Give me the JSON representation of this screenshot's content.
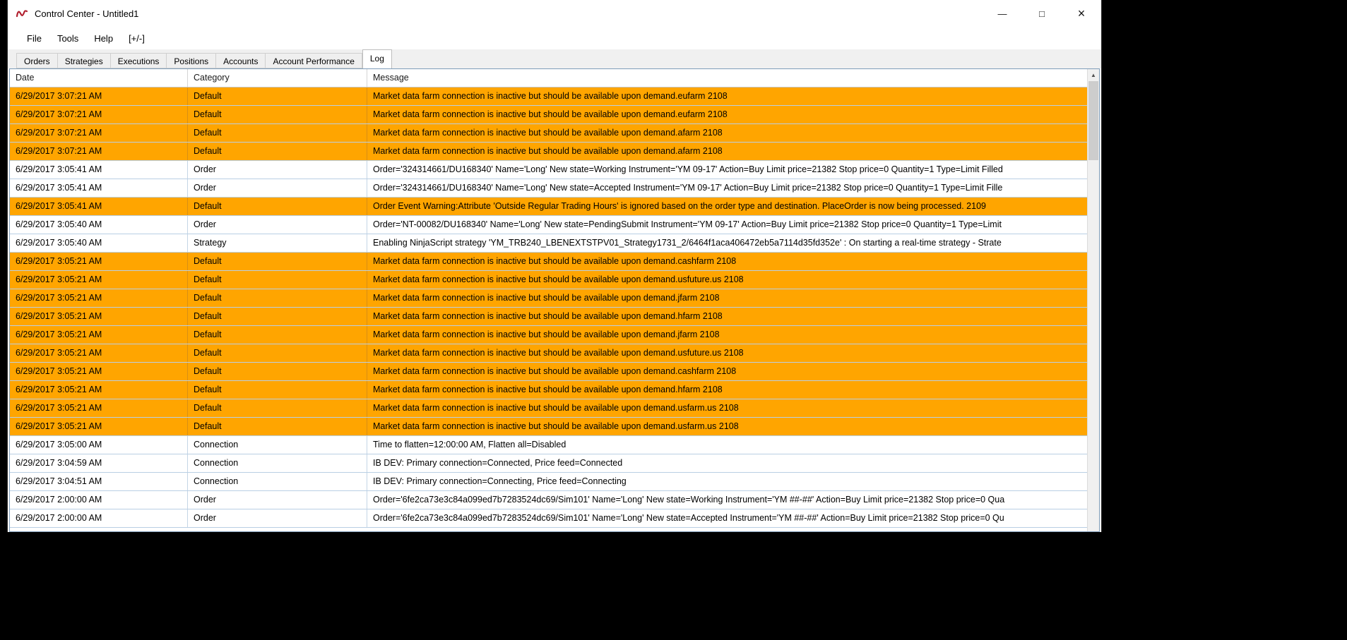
{
  "window": {
    "title": "Control Center - Untitled1",
    "controls": {
      "minimize": "—",
      "maximize": "□",
      "close": "×"
    }
  },
  "menu": {
    "items": [
      "File",
      "Tools",
      "Help",
      "[+/-]"
    ]
  },
  "tabs": [
    {
      "label": "Orders",
      "active": false
    },
    {
      "label": "Strategies",
      "active": false
    },
    {
      "label": "Executions",
      "active": false
    },
    {
      "label": "Positions",
      "active": false
    },
    {
      "label": "Accounts",
      "active": false
    },
    {
      "label": "Account Performance",
      "active": false
    },
    {
      "label": "Log",
      "active": true
    }
  ],
  "table": {
    "columns": [
      "Date",
      "Category",
      "Message"
    ],
    "rows": [
      {
        "date": "6/29/2017 3:07:21 AM",
        "category": "Default",
        "message": "Market data farm connection is inactive but should be available upon demand.eufarm 2108",
        "highlight": true
      },
      {
        "date": "6/29/2017 3:07:21 AM",
        "category": "Default",
        "message": "Market data farm connection is inactive but should be available upon demand.eufarm 2108",
        "highlight": true
      },
      {
        "date": "6/29/2017 3:07:21 AM",
        "category": "Default",
        "message": "Market data farm connection is inactive but should be available upon demand.afarm 2108",
        "highlight": true
      },
      {
        "date": "6/29/2017 3:07:21 AM",
        "category": "Default",
        "message": "Market data farm connection is inactive but should be available upon demand.afarm 2108",
        "highlight": true
      },
      {
        "date": "6/29/2017 3:05:41 AM",
        "category": "Order",
        "message": "Order='324314661/DU168340' Name='Long' New state=Working Instrument='YM 09-17' Action=Buy Limit price=21382 Stop price=0 Quantity=1 Type=Limit Filled",
        "highlight": false
      },
      {
        "date": "6/29/2017 3:05:41 AM",
        "category": "Order",
        "message": "Order='324314661/DU168340' Name='Long' New state=Accepted Instrument='YM 09-17' Action=Buy Limit price=21382 Stop price=0 Quantity=1 Type=Limit Fille",
        "highlight": false
      },
      {
        "date": "6/29/2017 3:05:41 AM",
        "category": "Default",
        "message": "Order Event Warning:Attribute 'Outside Regular Trading Hours' is ignored based on the order type and destination. PlaceOrder is now being processed. 2109",
        "highlight": true
      },
      {
        "date": "6/29/2017 3:05:40 AM",
        "category": "Order",
        "message": "Order='NT-00082/DU168340' Name='Long' New state=PendingSubmit Instrument='YM 09-17' Action=Buy Limit price=21382 Stop price=0 Quantity=1 Type=Limit",
        "highlight": false
      },
      {
        "date": "6/29/2017 3:05:40 AM",
        "category": "Strategy",
        "message": "Enabling NinjaScript strategy 'YM_TRB240_LBENEXTSTPV01_Strategy1731_2/6464f1aca406472eb5a7114d35fd352e' : On starting a real-time strategy - Strate",
        "highlight": false
      },
      {
        "date": "6/29/2017 3:05:21 AM",
        "category": "Default",
        "message": "Market data farm connection is inactive but should be available upon demand.cashfarm 2108",
        "highlight": true
      },
      {
        "date": "6/29/2017 3:05:21 AM",
        "category": "Default",
        "message": "Market data farm connection is inactive but should be available upon demand.usfuture.us 2108",
        "highlight": true
      },
      {
        "date": "6/29/2017 3:05:21 AM",
        "category": "Default",
        "message": "Market data farm connection is inactive but should be available upon demand.jfarm 2108",
        "highlight": true
      },
      {
        "date": "6/29/2017 3:05:21 AM",
        "category": "Default",
        "message": "Market data farm connection is inactive but should be available upon demand.hfarm 2108",
        "highlight": true
      },
      {
        "date": "6/29/2017 3:05:21 AM",
        "category": "Default",
        "message": "Market data farm connection is inactive but should be available upon demand.jfarm 2108",
        "highlight": true
      },
      {
        "date": "6/29/2017 3:05:21 AM",
        "category": "Default",
        "message": "Market data farm connection is inactive but should be available upon demand.usfuture.us 2108",
        "highlight": true
      },
      {
        "date": "6/29/2017 3:05:21 AM",
        "category": "Default",
        "message": "Market data farm connection is inactive but should be available upon demand.cashfarm 2108",
        "highlight": true
      },
      {
        "date": "6/29/2017 3:05:21 AM",
        "category": "Default",
        "message": "Market data farm connection is inactive but should be available upon demand.hfarm 2108",
        "highlight": true
      },
      {
        "date": "6/29/2017 3:05:21 AM",
        "category": "Default",
        "message": "Market data farm connection is inactive but should be available upon demand.usfarm.us 2108",
        "highlight": true
      },
      {
        "date": "6/29/2017 3:05:21 AM",
        "category": "Default",
        "message": "Market data farm connection is inactive but should be available upon demand.usfarm.us 2108",
        "highlight": true
      },
      {
        "date": "6/29/2017 3:05:00 AM",
        "category": "Connection",
        "message": "Time to flatten=12:00:00 AM, Flatten all=Disabled",
        "highlight": false
      },
      {
        "date": "6/29/2017 3:04:59 AM",
        "category": "Connection",
        "message": "IB DEV: Primary connection=Connected, Price feed=Connected",
        "highlight": false
      },
      {
        "date": "6/29/2017 3:04:51 AM",
        "category": "Connection",
        "message": "IB DEV: Primary connection=Connecting, Price feed=Connecting",
        "highlight": false
      },
      {
        "date": "6/29/2017 2:00:00 AM",
        "category": "Order",
        "message": "Order='6fe2ca73e3c84a099ed7b7283524dc69/Sim101' Name='Long' New state=Working Instrument='YM ##-##' Action=Buy Limit price=21382 Stop price=0 Qua",
        "highlight": false
      },
      {
        "date": "6/29/2017 2:00:00 AM",
        "category": "Order",
        "message": "Order='6fe2ca73e3c84a099ed7b7283524dc69/Sim101' Name='Long' New state=Accepted Instrument='YM ##-##' Action=Buy Limit price=21382 Stop price=0 Qu",
        "highlight": false
      }
    ]
  },
  "scrollbar": {
    "up_arrow": "▲"
  },
  "colors": {
    "highlight_row": "#FFA500",
    "row_grid": "#B9CFE4",
    "tab_bar_bg": "#F0F0F0",
    "logo_red": "#B11F2E"
  }
}
